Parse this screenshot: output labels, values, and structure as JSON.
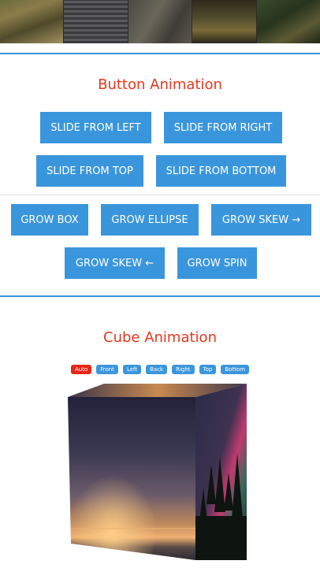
{
  "strip": {
    "tiles": [
      "grass-photo",
      "roof-tiles-photo",
      "stone-photo",
      "water-photo",
      "forest-photo"
    ]
  },
  "button_section": {
    "title": "Button Animation",
    "slide_buttons": [
      "SLIDE FROM LEFT",
      "SLIDE FROM RIGHT",
      "SLIDE FROM TOP",
      "SLIDE FROM BOTTOM"
    ],
    "grow_buttons": [
      "GROW BOX",
      "GROW ELLIPSE",
      "GROW SKEW →",
      "GROW SKEW ←",
      "GROW SPIN"
    ]
  },
  "cube_section": {
    "title": "Cube Animation",
    "controls": [
      {
        "label": "Auto",
        "active": true
      },
      {
        "label": "Front",
        "active": false
      },
      {
        "label": "Left",
        "active": false
      },
      {
        "label": "Back",
        "active": false
      },
      {
        "label": "Right",
        "active": false
      },
      {
        "label": "Top",
        "active": false
      },
      {
        "label": "Bottom",
        "active": false
      }
    ],
    "faces": [
      "front-face-sunset",
      "right-face-aurora-forest",
      "top-face-sky"
    ]
  },
  "colors": {
    "accent": "#3a96dc",
    "title": "#e8361c",
    "active_pill": "#e8251a"
  }
}
